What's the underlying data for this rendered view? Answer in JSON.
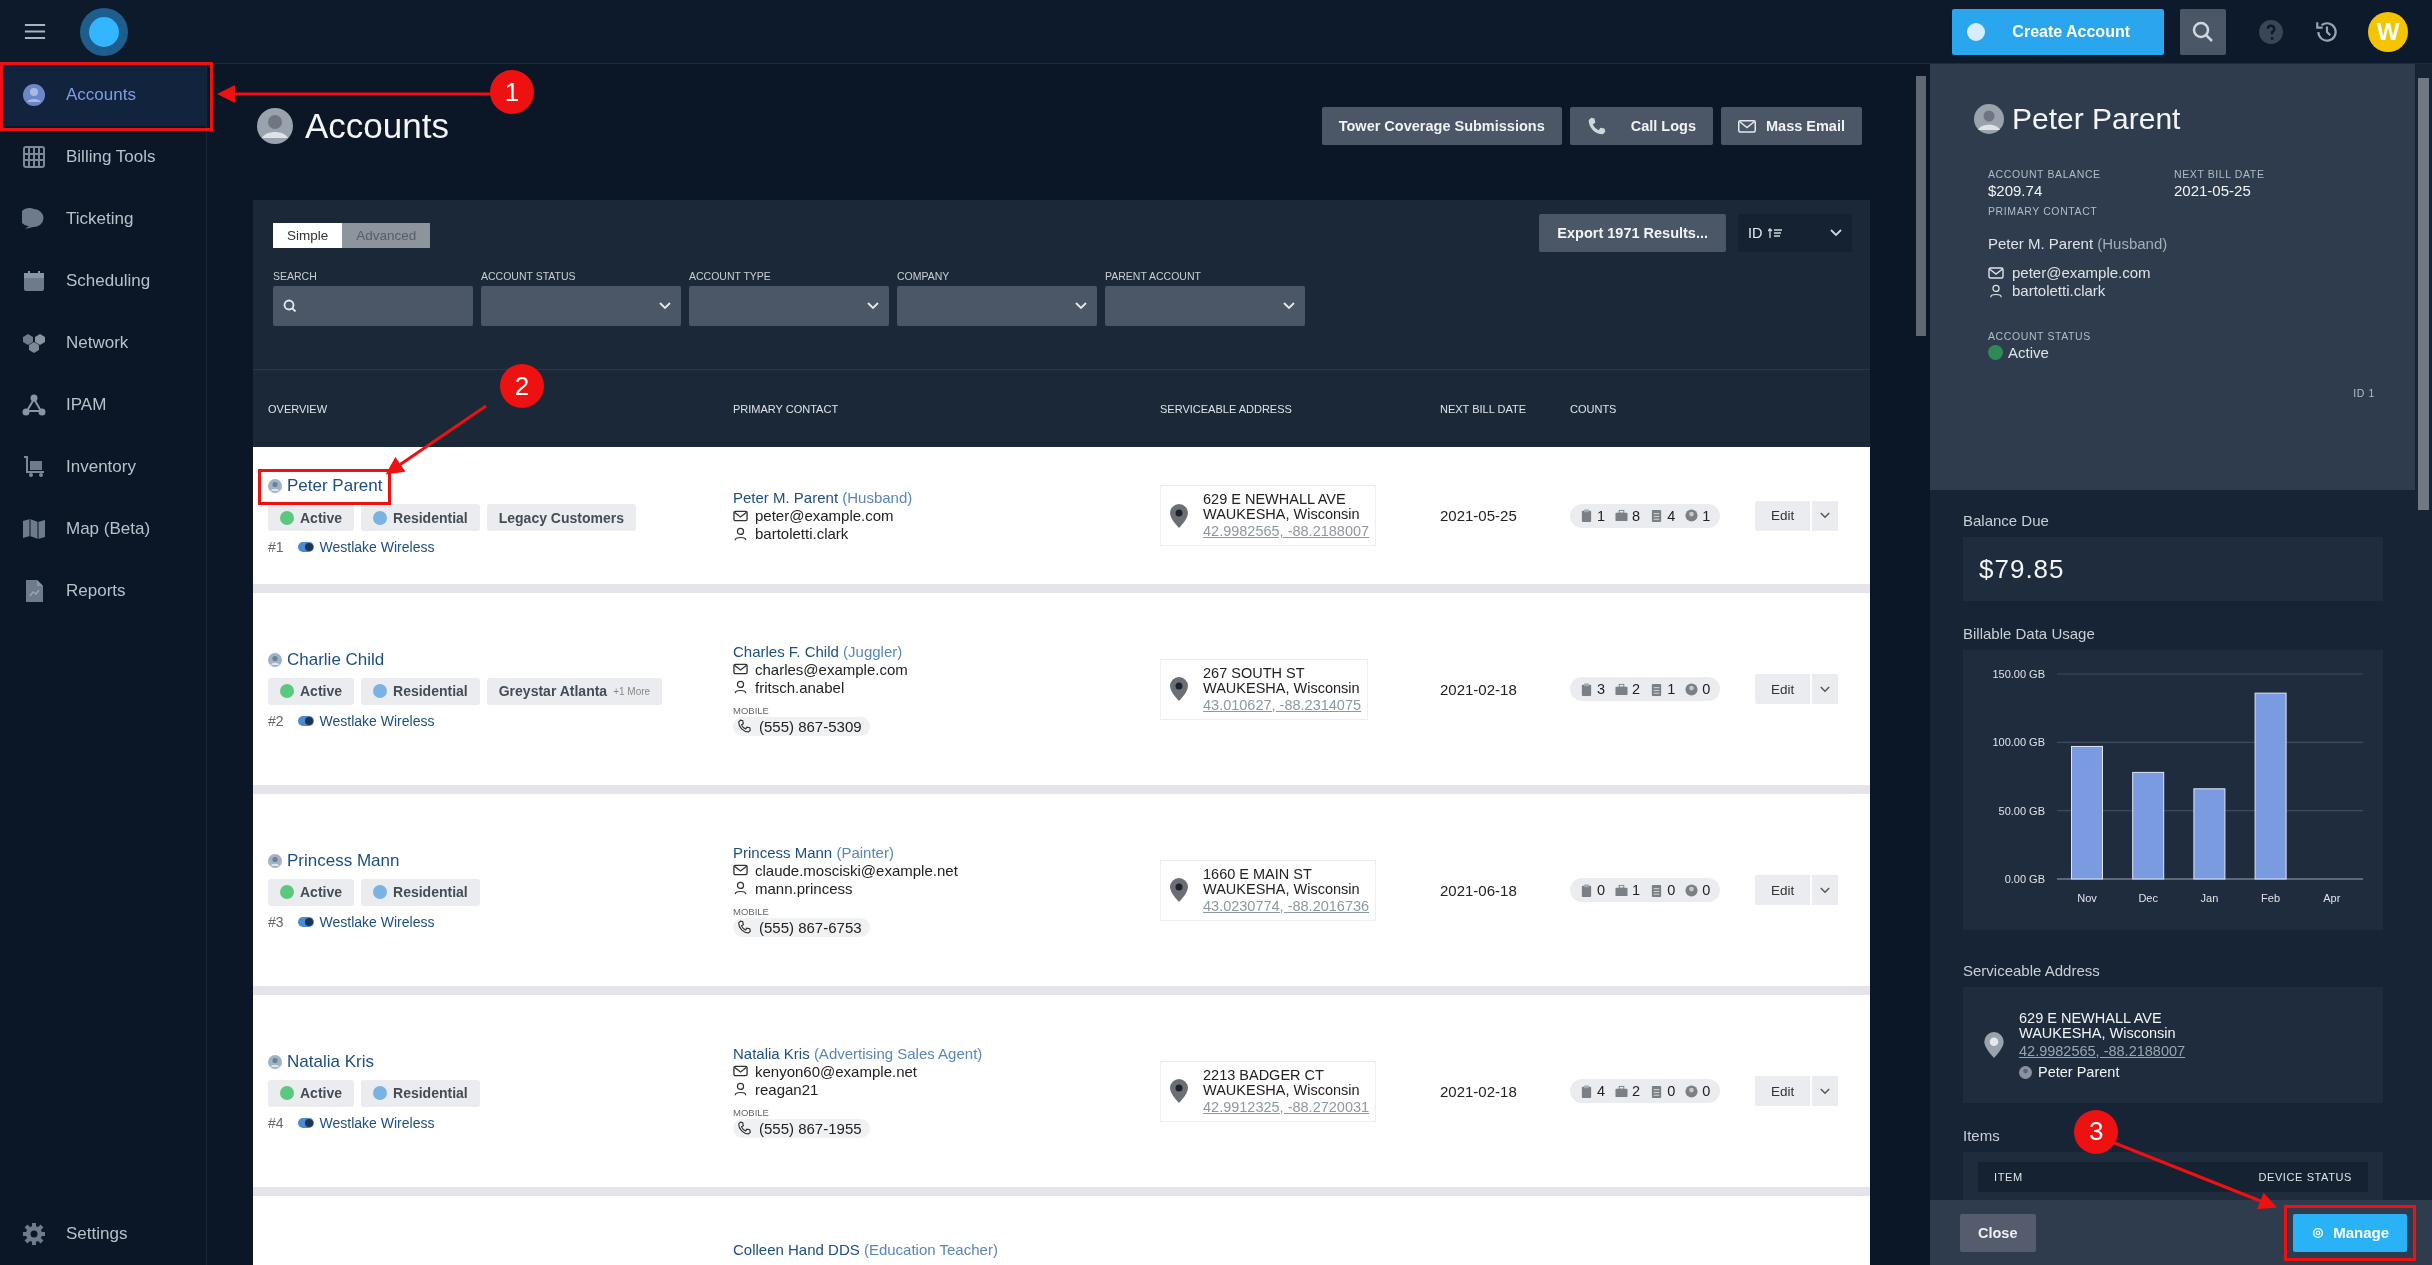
{
  "topbar": {
    "create_button": "Create Account",
    "avatar": "W"
  },
  "sidebar": {
    "items": [
      {
        "label": "Accounts",
        "kind": "person",
        "selected": true,
        "callout": "1"
      },
      {
        "label": "Billing Tools",
        "kind": "abacus",
        "selected": false
      },
      {
        "label": "Ticketing",
        "kind": "bubble",
        "selected": false
      },
      {
        "label": "Scheduling",
        "kind": "calendar",
        "selected": false
      },
      {
        "label": "Network",
        "kind": "cubes",
        "selected": false
      },
      {
        "label": "IPAM",
        "kind": "nodes",
        "selected": false
      },
      {
        "label": "Inventory",
        "kind": "cart",
        "selected": false
      },
      {
        "label": "Map (Beta)",
        "kind": "map",
        "selected": false
      },
      {
        "label": "Reports",
        "kind": "report",
        "selected": false
      }
    ],
    "settings": "Settings"
  },
  "page": {
    "title": "Accounts",
    "actions": [
      {
        "label": "Tower Coverage Submissions",
        "kind": "plain"
      },
      {
        "label": "Call Logs",
        "kind": "phone"
      },
      {
        "label": "Mass Email",
        "kind": "mail"
      }
    ]
  },
  "filters": {
    "modes": [
      {
        "label": "Simple",
        "selected": true
      },
      {
        "label": "Advanced",
        "selected": false
      }
    ],
    "export": "Export 1971 Results...",
    "sort": "ID",
    "fields": [
      {
        "label": "SEARCH",
        "kind": "search"
      },
      {
        "label": "ACCOUNT STATUS",
        "kind": "select"
      },
      {
        "label": "ACCOUNT TYPE",
        "kind": "select"
      },
      {
        "label": "COMPANY",
        "kind": "select"
      },
      {
        "label": "PARENT ACCOUNT",
        "kind": "select"
      }
    ]
  },
  "table": {
    "columns": [
      "OVERVIEW",
      "PRIMARY CONTACT",
      "SERVICEABLE ADDRESS",
      "NEXT BILL DATE",
      "COUNTS"
    ],
    "rows": [
      {
        "name": "Peter Parent",
        "callout": "2",
        "tags": [
          {
            "label": "Active",
            "color": "#5cc87f"
          },
          {
            "label": "Residential",
            "color": "#7ab3e3"
          },
          {
            "label": "Legacy Customers"
          }
        ],
        "number": "#1",
        "company": "Westlake Wireless",
        "contact": {
          "name": "Peter M. Parent",
          "role": "(Husband)",
          "email": "peter@example.com",
          "username": "bartoletti.clark"
        },
        "address": {
          "line1": "629 E NEWHALL AVE",
          "line2": "WAUKESHA, Wisconsin",
          "coords": "42.9982565, -88.2188007"
        },
        "next_bill": "2021-05-25",
        "counts": [
          "1",
          "8",
          "4",
          "1"
        ],
        "edit": "Edit"
      },
      {
        "name": "Charlie Child",
        "tags": [
          {
            "label": "Active",
            "color": "#5cc87f"
          },
          {
            "label": "Residential",
            "color": "#7ab3e3"
          },
          {
            "label": "Greystar Atlanta",
            "more": "+1 More"
          }
        ],
        "number": "#2",
        "company": "Westlake Wireless",
        "contact": {
          "name": "Charles F. Child",
          "role": "(Juggler)",
          "email": "charles@example.com",
          "username": "fritsch.anabel",
          "mobile_label": "MOBILE",
          "phone": "(555) 867-5309"
        },
        "address": {
          "line1": "267 SOUTH ST",
          "line2": "WAUKESHA, Wisconsin",
          "coords": "43.010627, -88.2314075"
        },
        "next_bill": "2021-02-18",
        "counts": [
          "3",
          "2",
          "1",
          "0"
        ],
        "edit": "Edit"
      },
      {
        "name": "Princess Mann",
        "tags": [
          {
            "label": "Active",
            "color": "#5cc87f"
          },
          {
            "label": "Residential",
            "color": "#7ab3e3"
          }
        ],
        "number": "#3",
        "company": "Westlake Wireless",
        "contact": {
          "name": "Princess Mann",
          "role": "(Painter)",
          "email": "claude.mosciski@example.net",
          "username": "mann.princess",
          "mobile_label": "MOBILE",
          "phone": "(555) 867-6753"
        },
        "address": {
          "line1": "1660 E MAIN ST",
          "line2": "WAUKESHA, Wisconsin",
          "coords": "43.0230774, -88.2016736"
        },
        "next_bill": "2021-06-18",
        "counts": [
          "0",
          "1",
          "0",
          "0"
        ],
        "edit": "Edit"
      },
      {
        "name": "Natalia Kris",
        "tags": [
          {
            "label": "Active",
            "color": "#5cc87f"
          },
          {
            "label": "Residential",
            "color": "#7ab3e3"
          }
        ],
        "number": "#4",
        "company": "Westlake Wireless",
        "contact": {
          "name": "Natalia Kris",
          "role": "(Advertising Sales Agent)",
          "email": "kenyon60@example.net",
          "username": "reagan21",
          "mobile_label": "MOBILE",
          "phone": "(555) 867-1955"
        },
        "address": {
          "line1": "2213 BADGER CT",
          "line2": "WAUKESHA, Wisconsin",
          "coords": "42.9912325, -88.2720031"
        },
        "next_bill": "2021-02-18",
        "counts": [
          "4",
          "2",
          "0",
          "0"
        ],
        "edit": "Edit"
      },
      {
        "contact": {
          "name": "Colleen Hand DDS",
          "role": "(Education Teacher)"
        }
      }
    ]
  },
  "panel": {
    "name": "Peter Parent",
    "balance_label": "ACCOUNT BALANCE",
    "balance": "$209.74",
    "bill_label": "NEXT BILL DATE",
    "bill_date": "2021-05-25",
    "contact_label": "PRIMARY CONTACT",
    "contact_name": "Peter M. Parent",
    "contact_role": "(Husband)",
    "email": "peter@example.com",
    "username": "bartoletti.clark",
    "status_label": "ACCOUNT STATUS",
    "status": {
      "label": "Active",
      "color": "#2e8b57"
    },
    "id": "ID 1",
    "balance_due_label": "Balance Due",
    "balance_due": "$79.85",
    "usage_title": "Billable Data Usage",
    "chart_data": {
      "type": "bar",
      "categories": [
        "Nov",
        "Dec",
        "Jan",
        "Feb",
        "Apr"
      ],
      "values": [
        97,
        78,
        66,
        136,
        0
      ],
      "ylim": [
        0,
        150
      ],
      "yticks": [
        {
          "value": 0,
          "label": "0.00 GB"
        },
        {
          "value": 50,
          "label": "50.00 GB"
        },
        {
          "value": 100,
          "label": "100.00 GB"
        },
        {
          "value": 150,
          "label": "150.00 GB"
        }
      ]
    },
    "address_title": "Serviceable Address",
    "address": {
      "line1": "629 E NEWHALL AVE",
      "line2": "WAUKESHA, Wisconsin",
      "coords": "42.9982565, -88.2188007",
      "owner": "Peter Parent"
    },
    "items_title": "Items",
    "items_columns": [
      "ITEM",
      "DEVICE STATUS"
    ],
    "close": "Close",
    "manage": "Manage",
    "manage_callout": "3"
  }
}
